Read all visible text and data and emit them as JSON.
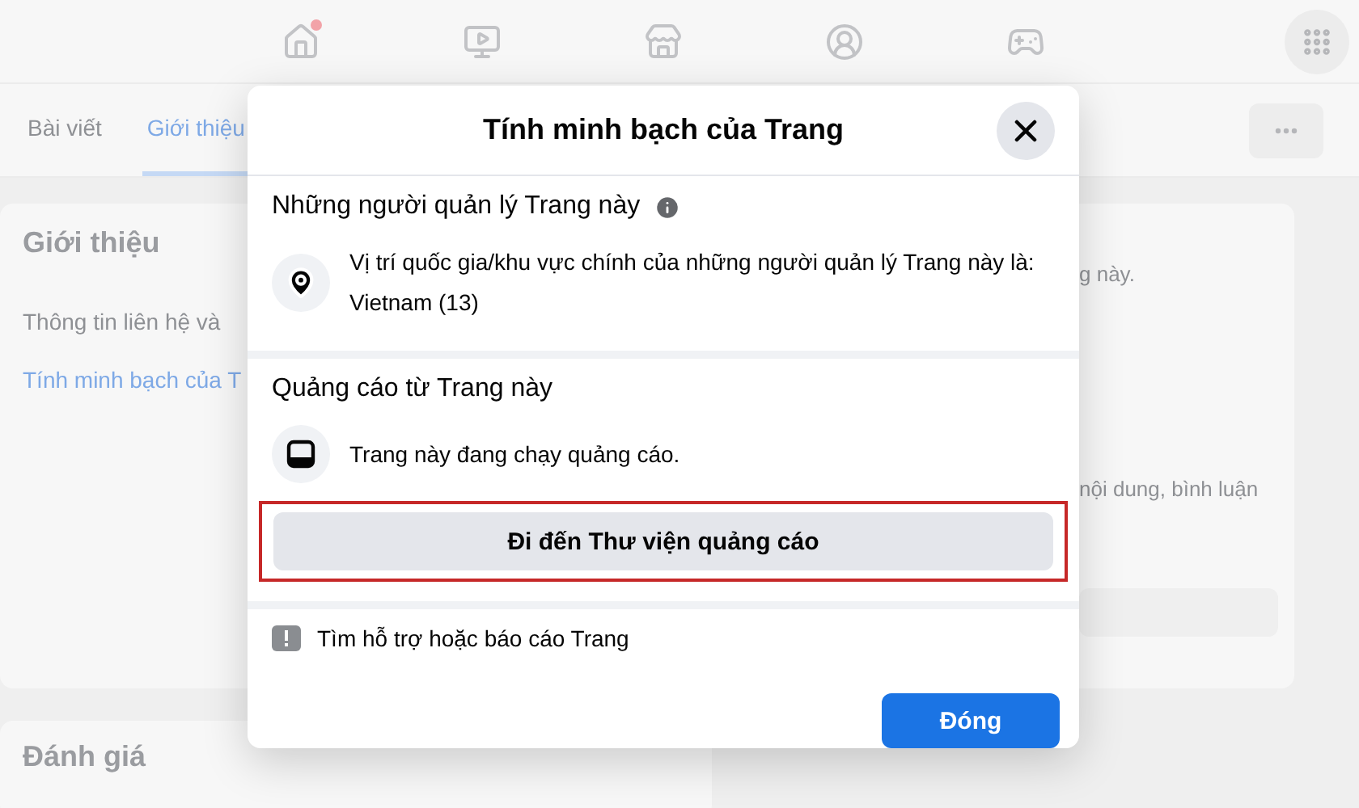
{
  "top_nav": {
    "items": [
      {
        "kind": "home",
        "badge": true
      },
      {
        "kind": "video",
        "badge": false
      },
      {
        "kind": "store",
        "badge": false
      },
      {
        "kind": "groups",
        "badge": false
      },
      {
        "kind": "gaming",
        "badge": false
      }
    ]
  },
  "tabs": [
    {
      "label": "Bài viết",
      "selected": false
    },
    {
      "label": "Giới thiệu",
      "selected": true
    }
  ],
  "about_card": {
    "title": "Giới thiệu",
    "items": [
      {
        "label": "Thông tin liên hệ và",
        "selected": false
      },
      {
        "label": "Tính minh bạch của T",
        "selected": true
      }
    ]
  },
  "right_card": {
    "lines": [
      "g này.",
      "nội dung, bình luận"
    ]
  },
  "reviews_card": {
    "title": "Đánh giá"
  },
  "dialog": {
    "title": "Tính minh bạch của Trang",
    "sections": [
      {
        "heading": "Những người quản lý Trang này",
        "info": true,
        "rows": [
          {
            "kind": "location",
            "text": "Vị trí quốc gia/khu vực chính của những người quản lý Trang này là: Vietnam (13)"
          }
        ]
      },
      {
        "heading": "Quảng cáo từ Trang này",
        "info": false,
        "rows": [
          {
            "kind": "ads",
            "text": "Trang này đang chạy quảng cáo."
          }
        ],
        "button": {
          "label": "Đi đến Thư viện quảng cáo",
          "highlighted": true
        }
      }
    ],
    "report_link": "Tìm hỗ trợ hoặc báo cáo Trang",
    "close_button": "Đóng"
  }
}
